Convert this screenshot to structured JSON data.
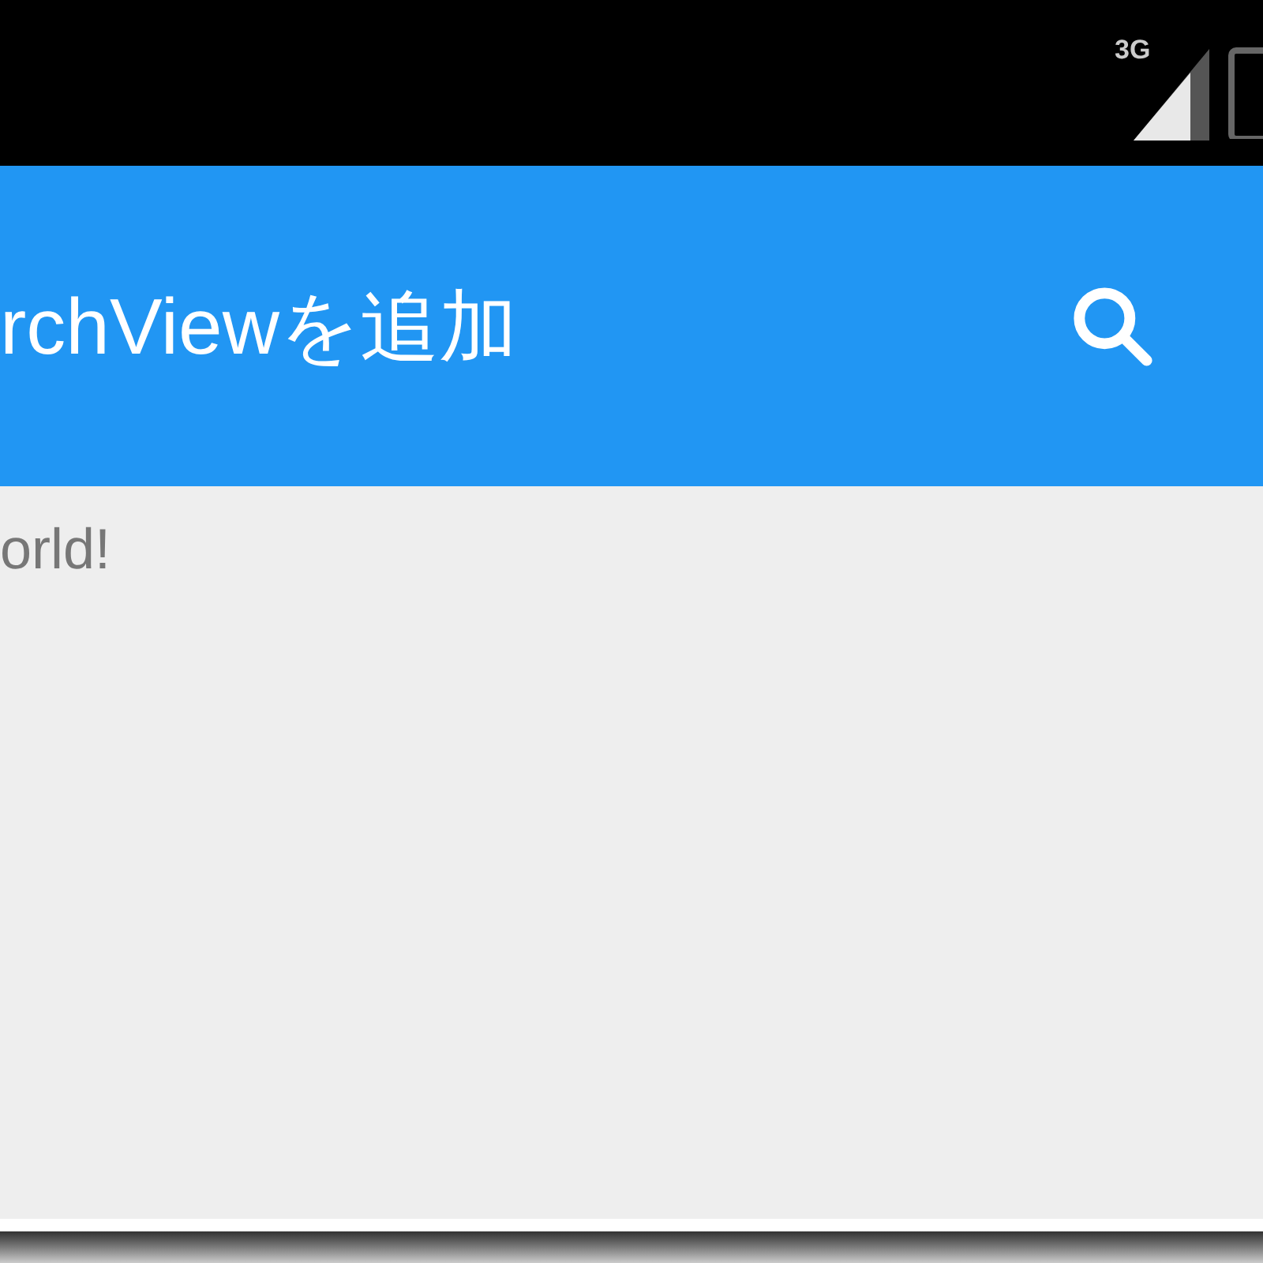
{
  "status_bar": {
    "network": "3G"
  },
  "app_bar": {
    "title": "rchViewを追加"
  },
  "content": {
    "text": "orld!"
  }
}
